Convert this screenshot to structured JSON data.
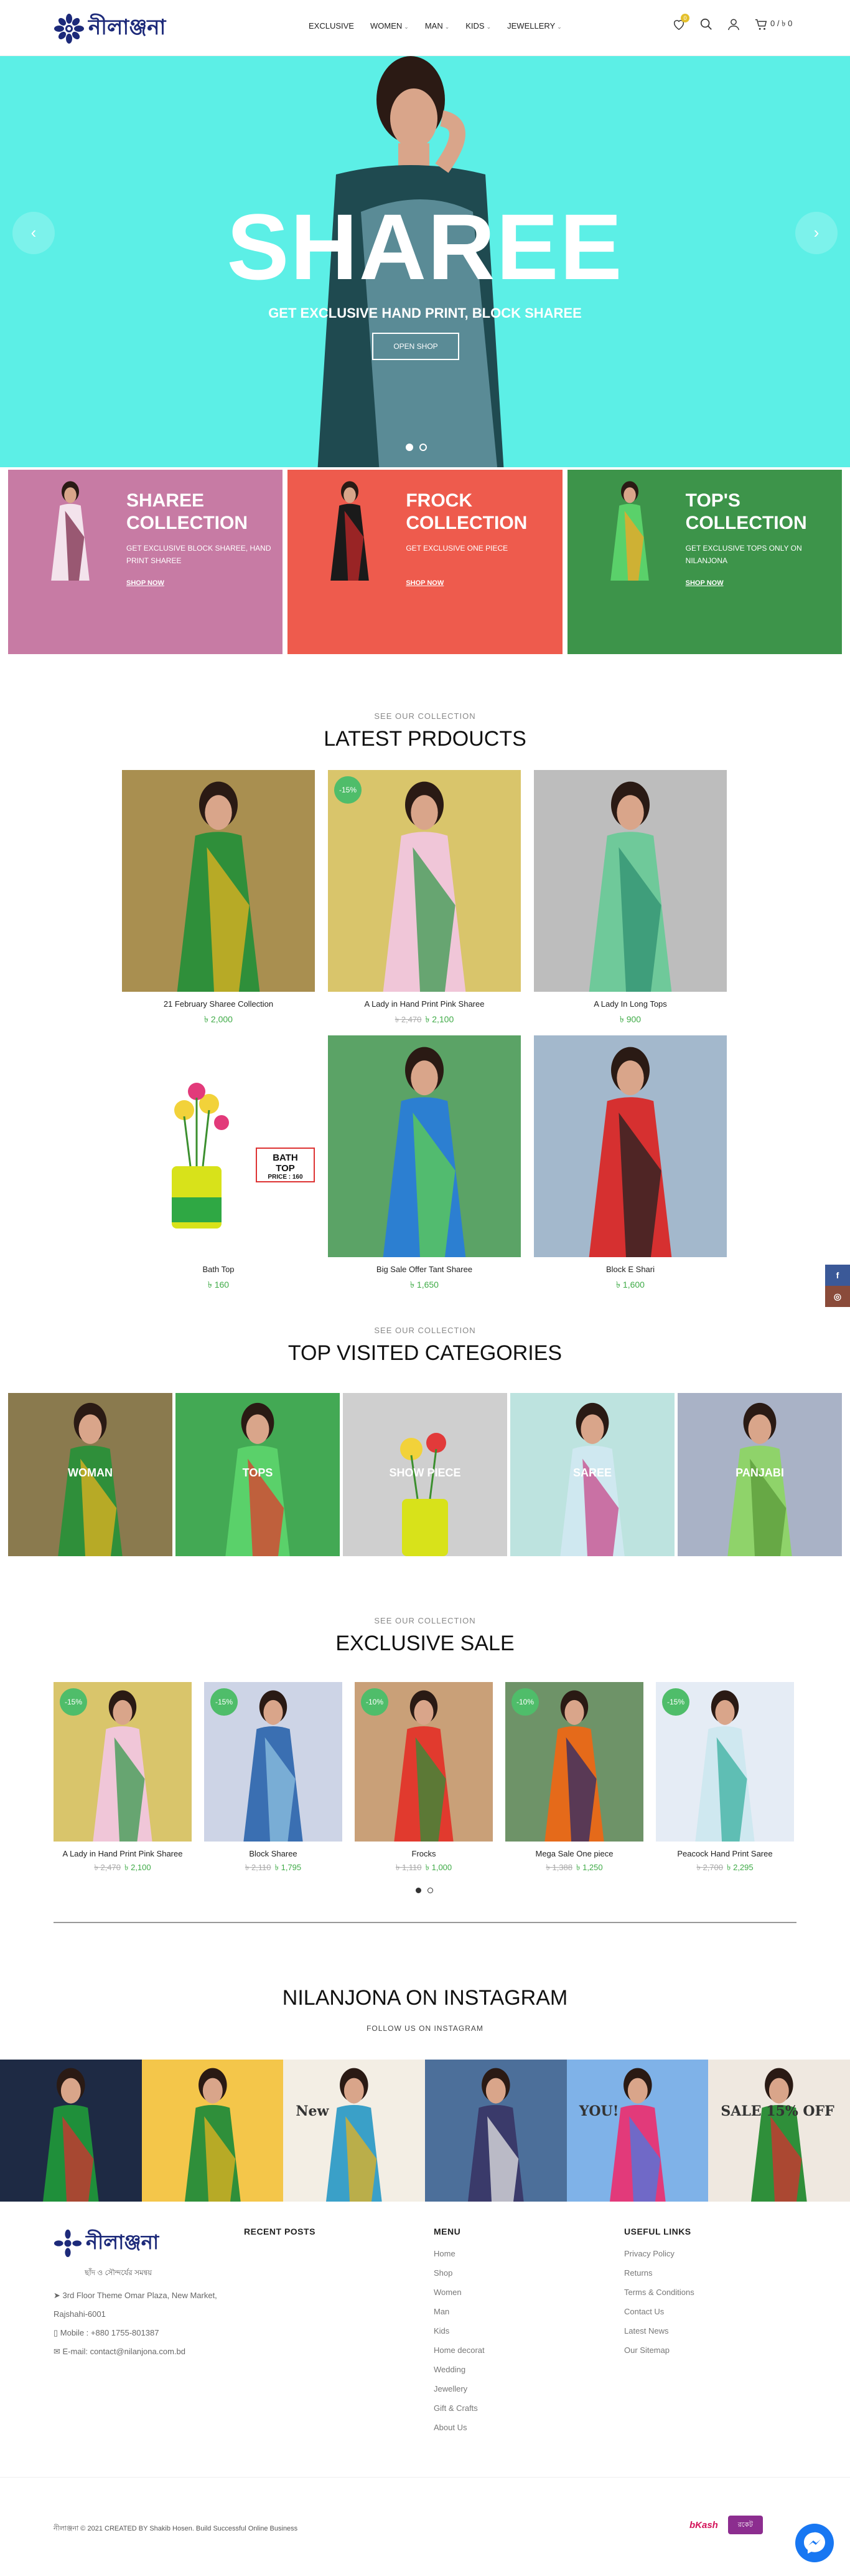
{
  "header": {
    "logo_text": "নীলাঞ্জনা",
    "nav": [
      {
        "label": "EXCLUSIVE",
        "has_menu": false
      },
      {
        "label": "WOMEN",
        "has_menu": true
      },
      {
        "label": "MAN",
        "has_menu": true
      },
      {
        "label": "KIDS",
        "has_menu": true
      },
      {
        "label": "JEWELLERY",
        "has_menu": true
      }
    ],
    "wishlist_count": "0",
    "cart_text": "0 / ৳ 0",
    "icons": [
      "heart-icon",
      "search-icon",
      "user-icon",
      "cart-icon"
    ]
  },
  "hero": {
    "title": "SHAREE",
    "subtitle": "GET EXCLUSIVE HAND PRINT, BLOCK SHAREE",
    "button": "OPEN SHOP",
    "prev": "‹",
    "next": "›"
  },
  "banners": [
    {
      "title": "SHAREE COLLECTION",
      "desc": "GET EXCLUSIVE BLOCK SHAREE, HAND PRINT SHAREE",
      "link": "SHOP NOW",
      "color": "#c77ba4"
    },
    {
      "title": "FROCK COLLECTION",
      "desc": "GET EXCLUSIVE ONE PIECE",
      "link": "SHOP NOW",
      "color": "#ee5b4d"
    },
    {
      "title": "TOP'S COLLECTION",
      "desc": "GET EXCLUSIVE TOPS ONLY ON NILANJONA",
      "link": "SHOP NOW",
      "color": "#3d944a"
    }
  ],
  "latest": {
    "pre": "SEE OUR COLLECTION",
    "title": "LATEST PRDOUCTS",
    "products": [
      {
        "name": "21 February Sharee Collection",
        "old": "",
        "price": "৳ 2,000",
        "badge": "",
        "bg": "#a98f50"
      },
      {
        "name": "A Lady in Hand Print Pink Sharee",
        "old": "৳ 2,470",
        "price": "৳ 2,100",
        "badge": "-15%",
        "bg": "#d9c56b"
      },
      {
        "name": "A Lady In Long Tops",
        "old": "",
        "price": "৳ 900",
        "badge": "",
        "bg": "#bdbdbd"
      },
      {
        "name": "Bath Top",
        "old": "",
        "price": "৳ 160",
        "badge": "",
        "bg": "#ffffff"
      },
      {
        "name": "Big Sale Offer Tant Sharee",
        "old": "",
        "price": "৳ 1,650",
        "badge": "",
        "bg": "#5ba366"
      },
      {
        "name": "Block E Shari",
        "old": "",
        "price": "৳ 1,600",
        "badge": "",
        "bg": "#a3b8cc"
      }
    ],
    "bath_tag": "BATH TOP",
    "bath_price": "PRICE : 160"
  },
  "categories": {
    "pre": "SEE OUR COLLECTION",
    "title": "TOP VISITED CATEGORIES",
    "items": [
      {
        "name": "WOMAN",
        "bg": "#8a7a4e"
      },
      {
        "name": "TOPS",
        "bg": "#43a954"
      },
      {
        "name": "SHOW PIECE",
        "bg": "#cfcfcf"
      },
      {
        "name": "SAREE",
        "bg": "#bde3df"
      },
      {
        "name": "PANJABI",
        "bg": "#a9b2c6"
      }
    ]
  },
  "exclusive": {
    "pre": "SEE OUR COLLECTION",
    "title": "EXCLUSIVE SALE",
    "products": [
      {
        "name": "A Lady in Hand Print Pink Sharee",
        "old": "৳ 2,470",
        "price": "৳ 2,100",
        "badge": "-15%",
        "bg": "#d9c56b"
      },
      {
        "name": "Block Sharee",
        "old": "৳ 2,110",
        "price": "৳ 1,795",
        "badge": "-15%",
        "bg": "#cdd4e6"
      },
      {
        "name": "Frocks",
        "old": "৳ 1,110",
        "price": "৳ 1,000",
        "badge": "-10%",
        "bg": "#c9a078"
      },
      {
        "name": "Mega Sale One piece",
        "old": "৳ 1,388",
        "price": "৳ 1,250",
        "badge": "-10%",
        "bg": "#6e9368"
      },
      {
        "name": "Peacock Hand Print Saree",
        "old": "৳ 2,700",
        "price": "৳ 2,295",
        "badge": "-15%",
        "bg": "#e5ecf5"
      }
    ]
  },
  "instagram": {
    "title": "NILANJONA ON INSTAGRAM",
    "sub": "FOLLOW US ON INSTAGRAM",
    "tiles": [
      {
        "bg": "#1e2a44",
        "text": ""
      },
      {
        "bg": "#f4c64a",
        "text": ""
      },
      {
        "bg": "#f3eee4",
        "text": "New"
      },
      {
        "bg": "#4c6f9a",
        "text": ""
      },
      {
        "bg": "#7fb2e8",
        "text": "YOU!"
      },
      {
        "bg": "#efe8e0",
        "text": "SALE 15% OFF"
      }
    ]
  },
  "footer": {
    "tagline": "ছাঁদ ও সৌন্দর্যের সমন্বয়",
    "address": "3rd Floor Theme Omar Plaza, New Market, Rajshahi-6001",
    "mobile": "Mobile : +880 1755-801387",
    "email": "E-mail: contact@nilanjona.com.bd",
    "recent_title": "RECENT POSTS",
    "menu_title": "MENU",
    "menu": [
      "Home",
      "Shop",
      "Women",
      "Man",
      "Kids",
      "Home decorat",
      "Wedding",
      "Jewellery",
      "Gift & Crafts",
      "About Us"
    ],
    "useful_title": "USEFUL LINKS",
    "useful": [
      "Privacy Policy",
      "Returns",
      "Terms & Conditions",
      "Contact Us",
      "Latest News",
      "Our Sitemap"
    ],
    "copyright": "নীলাঞ্জনা © 2021 CREATED BY Shakib Hosen. Build Successful Online Business",
    "bkash": "bKash",
    "rocket": "রকেট"
  },
  "social": [
    {
      "label": "f",
      "bg": "#3b5998"
    },
    {
      "label": "◎",
      "bg": "#8a4b3a"
    }
  ]
}
